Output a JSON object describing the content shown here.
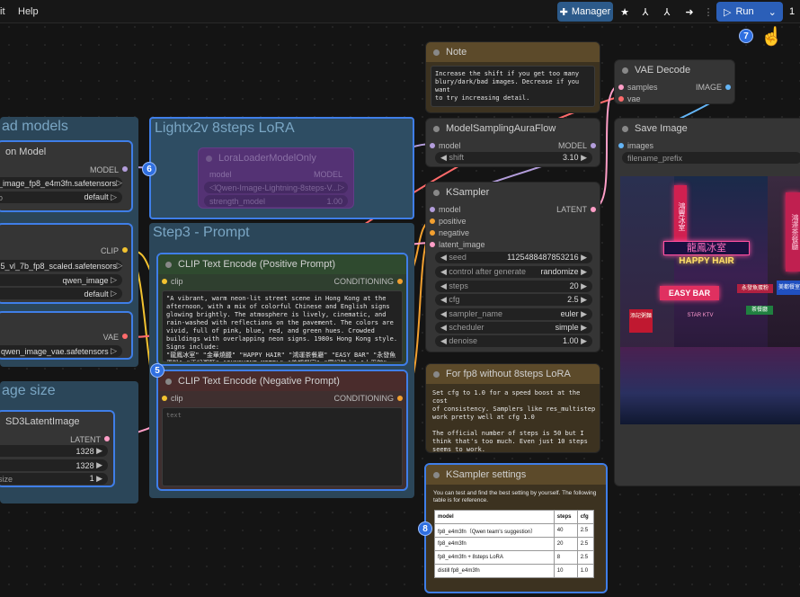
{
  "menu": {
    "item_partial": "it",
    "help": "Help"
  },
  "toolbar": {
    "manager": "Manager",
    "run": "Run",
    "run_count": "1"
  },
  "badges": {
    "b5": "5",
    "b6": "6",
    "b7": "7",
    "b8": "8"
  },
  "groups": {
    "load_models": "ad models",
    "lora": "Lightx2v 8steps LoRA",
    "prompt": "Step3 - Prompt",
    "image_size": "age size"
  },
  "unet_node": {
    "title": "on Model",
    "out": "MODEL",
    "unet_name": "_image_fp8_e4m3fn.safetensors",
    "weight_label": "o",
    "weight_dtype": "default"
  },
  "clip_node": {
    "out": "CLIP",
    "clip_name": ".5_vl_7b_fp8_scaled.safetensors",
    "type": "qwen_image",
    "device": "default"
  },
  "vae_loader": {
    "out": "VAE",
    "vae_name": "qwen_image_vae.safetensors"
  },
  "latent_node": {
    "title": "SD3LatentImage",
    "out": "LATENT",
    "width": "1328",
    "height": "1328",
    "batch_label": "size",
    "batch": "1"
  },
  "lora_node": {
    "title": "LoraLoaderModelOnly",
    "in": "model",
    "out": "MODEL",
    "lora_name": "Qwen-Image-Lightning-8steps-V...",
    "strength_label": "strength_model",
    "strength": "1.00"
  },
  "note_node": {
    "title": "Note",
    "text": "Increase the shift if you get too many\nblury/dark/bad images. Decrease if you want\nto try increasing detail."
  },
  "msaf_node": {
    "title": "ModelSamplingAuraFlow",
    "in": "model",
    "out": "MODEL",
    "shift_label": "shift",
    "shift": "3.10"
  },
  "ksampler": {
    "title": "KSampler",
    "in_model": "model",
    "in_positive": "positive",
    "in_negative": "negative",
    "in_latent": "latent_image",
    "out": "LATENT",
    "widgets": [
      {
        "label": "seed",
        "value": "1125488487853216"
      },
      {
        "label": "control after generate",
        "value": "randomize"
      },
      {
        "label": "steps",
        "value": "20"
      },
      {
        "label": "cfg",
        "value": "2.5"
      },
      {
        "label": "sampler_name",
        "value": "euler"
      },
      {
        "label": "scheduler",
        "value": "simple"
      },
      {
        "label": "denoise",
        "value": "1.00"
      }
    ]
  },
  "pos_prompt": {
    "title": "CLIP Text Encode (Positive Prompt)",
    "in": "clip",
    "out": "CONDITIONING",
    "text": "\"A vibrant, warm neon-lit street scene in Hong Kong at the afternoon, with a mix of colorful Chinese and English signs glowing brightly. The atmosphere is lively, cinematic, and rain-washed with reflections on the pavement. The colors are vivid, full of pink, blue, red, and green hues. Crowded buildings with overlapping neon signs. 1980s Hong Kong style. Signs include:\n\"龍鳳冰室\" \"金華燒臘\" \"HAPPY HAIR\" \"鴻運茶餐廳\" \"EASY BAR\" \"永發魚蛋粉\" \"添記粥麵\" \"SUNSHINE MOTEL\" \"美都餐室\" \"富記糖水\" \"太平館\" \"雅芳髮型\""
  },
  "neg_prompt": {
    "title": "CLIP Text Encode (Negative Prompt)",
    "in": "clip",
    "out": "CONDITIONING",
    "placeholder": "text"
  },
  "fp8_note": {
    "title": "For fp8 without 8steps LoRA",
    "text": "Set cfg to 1.0 for a speed boost at the cost\nof consistency. Samplers like res_multistep\nwork pretty well at cfg 1.0\n\nThe official number of steps is 50 but I\nthink that's too much. Even just 10 steps\nseems to work."
  },
  "ks_settings": {
    "title": "KSampler settings",
    "intro": "You can test and find the best setting by yourself. The following table is for reference.",
    "headers": [
      "model",
      "steps",
      "cfg"
    ],
    "rows": [
      [
        "fp8_e4m3fn（Qwen team's suggestion）",
        "40",
        "2.5"
      ],
      [
        "fp8_e4m3fn",
        "20",
        "2.5"
      ],
      [
        "fp8_e4m3fn + 8steps LoRA",
        "8",
        "2.5"
      ],
      [
        "distill fp8_e4m3fn",
        "10",
        "1.0"
      ]
    ]
  },
  "vae_decode": {
    "title": "VAE Decode",
    "in_samples": "samples",
    "in_vae": "vae",
    "out": "IMAGE"
  },
  "save_image": {
    "title": "Save Image",
    "in": "images",
    "prefix": "filename_prefix",
    "signs": {
      "s1": "龍鳳冰室",
      "s2": "HAPPY HAIR",
      "s3": "EASY BAR",
      "s4": "鴻運茶餐廳",
      "s5": "STAR KTV",
      "s6": "鴻豐冰室",
      "s7": "永發魚蛋粉",
      "s8": "美都餐室",
      "s9": "添記粥麵",
      "s10": "茶餐廳"
    }
  },
  "colors": {
    "selection": "#3f7ee8",
    "group_blue": "#2e4d63",
    "note": "#5c4a2a",
    "pos_header": "#2f4a2f",
    "neg_header": "#4a2c2c",
    "lora_purple": "#5b2e78"
  }
}
